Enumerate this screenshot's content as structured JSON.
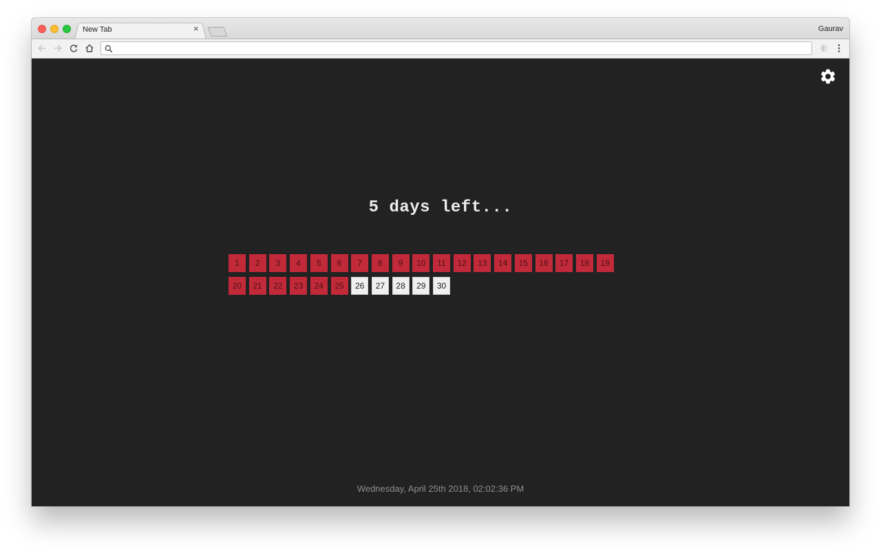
{
  "browser": {
    "tab_title": "New Tab",
    "tab_close": "×",
    "profile_name": "Gaurav",
    "omnibox_value": "",
    "omnibox_placeholder": ""
  },
  "countdown": {
    "headline": "5 days left...",
    "days": [
      "1",
      "2",
      "3",
      "4",
      "5",
      "6",
      "7",
      "8",
      "9",
      "10",
      "11",
      "12",
      "13",
      "14",
      "15",
      "16",
      "17",
      "18",
      "19",
      "20",
      "21",
      "22",
      "23",
      "24",
      "25",
      "26",
      "27",
      "28",
      "29",
      "30"
    ],
    "days_passed": 25,
    "colors": {
      "passed": "#c22a3a",
      "remaining": "#f0f0f0",
      "background": "#222222"
    }
  },
  "footer": {
    "timestamp": "Wednesday, April 25th 2018, 02:02:36 PM"
  },
  "icons": {
    "settings": "gear-icon",
    "back": "arrow-left-icon",
    "forward": "arrow-right-icon",
    "reload": "reload-icon",
    "home": "home-icon",
    "search": "search-icon",
    "extension": "extension-icon",
    "menu": "kebab-menu-icon"
  }
}
